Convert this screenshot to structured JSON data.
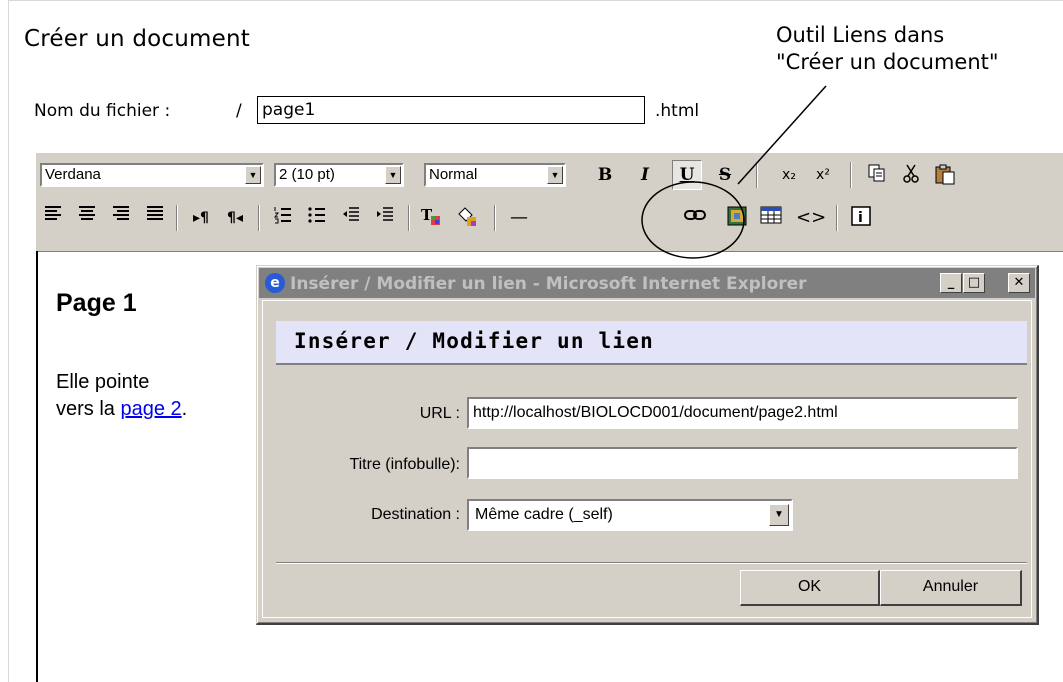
{
  "page": {
    "title": "Créer un document",
    "callout": "Outil Liens dans\n\"Créer un document\""
  },
  "file": {
    "label": "Nom du fichier :",
    "slash": "/",
    "value": "page1",
    "ext": ".html"
  },
  "toolbar": {
    "font": "Verdana",
    "size": "2 (10 pt)",
    "style": "Normal",
    "bold": "B",
    "italic": "I",
    "underline": "U",
    "strike": "S",
    "subscript": "x₂",
    "superscript": "x²"
  },
  "document": {
    "heading": "Page 1",
    "line1": "Elle pointe",
    "line2_prefix": "vers la ",
    "link_text": "page 2",
    "line2_suffix": "."
  },
  "dialog": {
    "window_title": "Insérer / Modifier un lien - Microsoft Internet Explorer",
    "header": "Insérer / Modifier un lien",
    "url_label": "URL :",
    "url_value": "http://localhost/BIOLOCD001/document/page2.html",
    "title_label": "Titre (infobulle):",
    "title_value": "",
    "dest_label": "Destination :",
    "dest_value": "Même cadre (_self)",
    "ok": "OK",
    "cancel": "Annuler"
  },
  "colors": {
    "toolbar_bg": "#d4d0c8",
    "dialog_header_bg": "#e4e4f8",
    "link": "#0000ee"
  }
}
